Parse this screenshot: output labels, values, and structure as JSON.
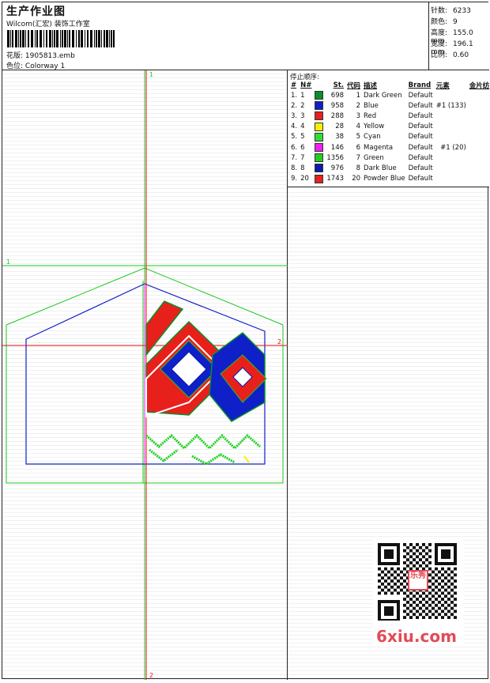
{
  "header": {
    "title": "生产作业图",
    "studio": "Wilcom(汇宏) 装饰工作室",
    "design_label": "花版:",
    "design_file": "1905813.emb",
    "colorway_label": "色位:",
    "colorway": "Colorway 1"
  },
  "specs": [
    {
      "key": "针数:",
      "value": "6233"
    },
    {
      "key": "颜色:",
      "value": "9"
    },
    {
      "key": "高度:",
      "value": "155.0 mm"
    },
    {
      "key": "宽度:",
      "value": "196.1 mm"
    },
    {
      "key": "比例:",
      "value": "0.60"
    }
  ],
  "table": {
    "title": "停止顺序:",
    "headers": [
      "#",
      "N#",
      "St.",
      "代码",
      "描述",
      "Brand",
      "元素",
      "金片纺"
    ],
    "rows": [
      {
        "idx": "1.",
        "n": "1",
        "st": "698",
        "code": "1",
        "desc": "Dark Green",
        "brand": "Default",
        "elem": "",
        "color": "#0a8f2a"
      },
      {
        "idx": "2.",
        "n": "2",
        "st": "958",
        "code": "2",
        "desc": "Blue",
        "brand": "Default",
        "elem": "#1 (133)",
        "color": "#1020c8"
      },
      {
        "idx": "3.",
        "n": "3",
        "st": "288",
        "code": "3",
        "desc": "Red",
        "brand": "Default",
        "elem": "",
        "color": "#e8201c"
      },
      {
        "idx": "4.",
        "n": "4",
        "st": "28",
        "code": "4",
        "desc": "Yellow",
        "brand": "Default",
        "elem": "",
        "color": "#f5f000"
      },
      {
        "idx": "5.",
        "n": "5",
        "st": "38",
        "code": "5",
        "desc": "Cyan",
        "brand": "Default",
        "elem": "",
        "color": "#30e030"
      },
      {
        "idx": "6.",
        "n": "6",
        "st": "146",
        "code": "6",
        "desc": "Magenta",
        "brand": "Default",
        "elem": "#1 (20)",
        "color": "#f020f0"
      },
      {
        "idx": "7.",
        "n": "7",
        "st": "1356",
        "code": "7",
        "desc": "Green",
        "brand": "Default",
        "elem": "",
        "color": "#20d020"
      },
      {
        "idx": "8.",
        "n": "8",
        "st": "976",
        "code": "8",
        "desc": "Dark Blue",
        "brand": "Default",
        "elem": "",
        "color": "#0a1ab0"
      },
      {
        "idx": "9.",
        "n": "20",
        "st": "1743",
        "code": "20",
        "desc": "Powder Blue",
        "brand": "Default",
        "elem": "",
        "color": "#e82020"
      }
    ]
  },
  "guides": {
    "v_top": "1",
    "v_bottom": "2",
    "h_left": "1",
    "h_right": "2"
  },
  "watermark": {
    "text": "6xiu.com",
    "qr_badge": "乐秀"
  },
  "colors": {
    "green_guide": "#1ec81e",
    "red_guide": "#e01010",
    "outline_blue": "#1020c8"
  }
}
